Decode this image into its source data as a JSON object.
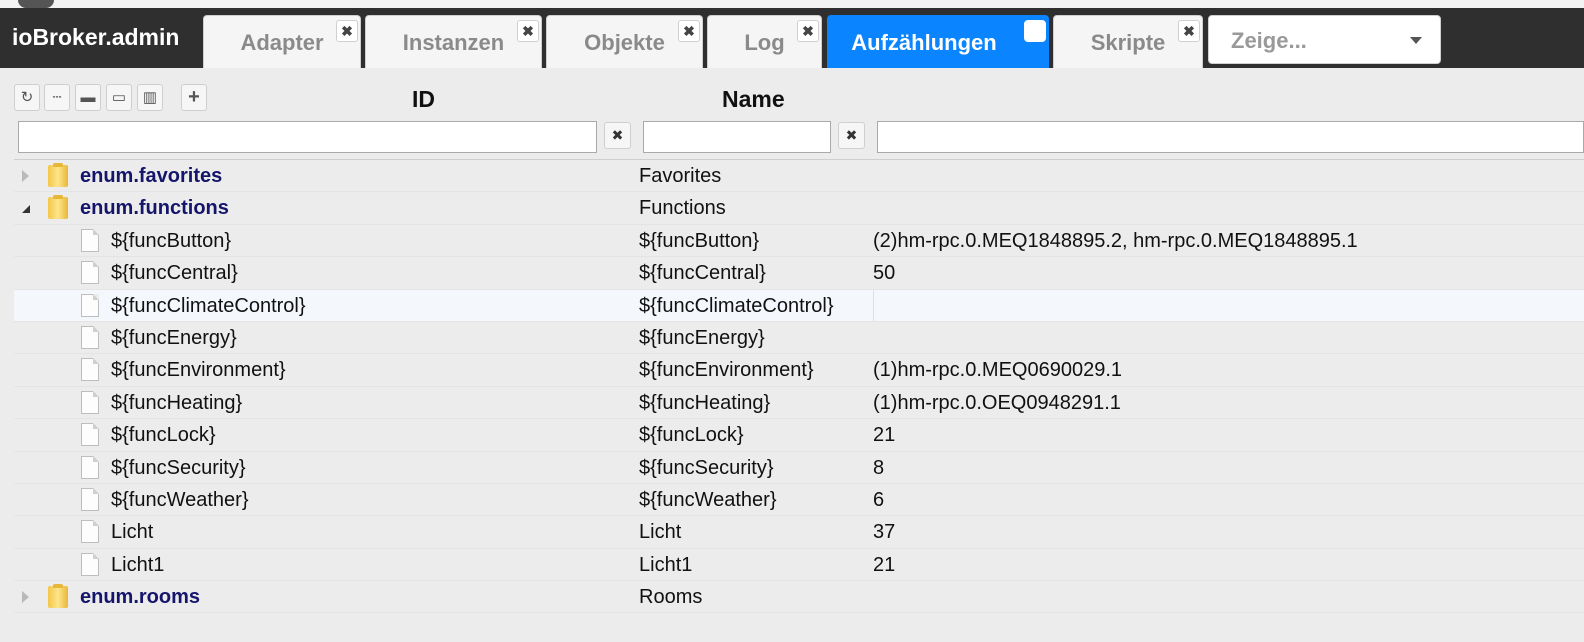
{
  "app": {
    "title": "ioBroker.admin"
  },
  "tabs": [
    {
      "label": "Adapter",
      "close": "✖",
      "active": false
    },
    {
      "label": "Instanzen",
      "close": "✖",
      "active": false
    },
    {
      "label": "Objekte",
      "close": "✖",
      "active": false
    },
    {
      "label": "Log",
      "close": "✖",
      "active": false
    },
    {
      "label": "Aufzählungen",
      "close": "",
      "active": true
    },
    {
      "label": "Skripte",
      "close": "✖",
      "active": false
    }
  ],
  "show_select": {
    "value": "Zeige..."
  },
  "toolbar": {
    "buttons": [
      {
        "icon": "refresh-icon",
        "glyph": "↻"
      },
      {
        "icon": "list-icon",
        "glyph": "┄"
      },
      {
        "icon": "folder-collapse-icon",
        "glyph": "▬"
      },
      {
        "icon": "folder-expand-icon",
        "glyph": "▭"
      },
      {
        "icon": "columns-icon",
        "glyph": "▥"
      },
      {
        "icon": "add-icon",
        "glyph": "+"
      }
    ]
  },
  "columns": {
    "id": "ID",
    "name": "Name"
  },
  "filters": {
    "id_value": "",
    "name_value": "",
    "members_value": "",
    "clear": "✖"
  },
  "tree": [
    {
      "id": "enum.favorites",
      "name": "Favorites",
      "value": "",
      "kind": "folder",
      "state": "collapsed"
    },
    {
      "id": "enum.functions",
      "name": "Functions",
      "value": "",
      "kind": "folder",
      "state": "expanded"
    },
    {
      "id": "${funcButton}",
      "name": "${funcButton}",
      "value": "(2)hm-rpc.0.MEQ1848895.2, hm-rpc.0.MEQ1848895.1",
      "kind": "item"
    },
    {
      "id": "${funcCentral}",
      "name": "${funcCentral}",
      "value": "50",
      "kind": "item"
    },
    {
      "id": "${funcClimateControl}",
      "name": "${funcClimateControl}",
      "value": "",
      "kind": "item",
      "hover": true
    },
    {
      "id": "${funcEnergy}",
      "name": "${funcEnergy}",
      "value": "",
      "kind": "item"
    },
    {
      "id": "${funcEnvironment}",
      "name": "${funcEnvironment}",
      "value": "(1)hm-rpc.0.MEQ0690029.1",
      "kind": "item"
    },
    {
      "id": "${funcHeating}",
      "name": "${funcHeating}",
      "value": "(1)hm-rpc.0.OEQ0948291.1",
      "kind": "item"
    },
    {
      "id": "${funcLock}",
      "name": "${funcLock}",
      "value": "21",
      "kind": "item"
    },
    {
      "id": "${funcSecurity}",
      "name": "${funcSecurity}",
      "value": "8",
      "kind": "item"
    },
    {
      "id": "${funcWeather}",
      "name": "${funcWeather}",
      "value": "6",
      "kind": "item"
    },
    {
      "id": "Licht",
      "name": "Licht",
      "value": "37",
      "kind": "item"
    },
    {
      "id": "Licht1",
      "name": "Licht1",
      "value": "21",
      "kind": "item"
    },
    {
      "id": "enum.rooms",
      "name": "Rooms",
      "value": "",
      "kind": "folder",
      "state": "collapsed"
    }
  ]
}
